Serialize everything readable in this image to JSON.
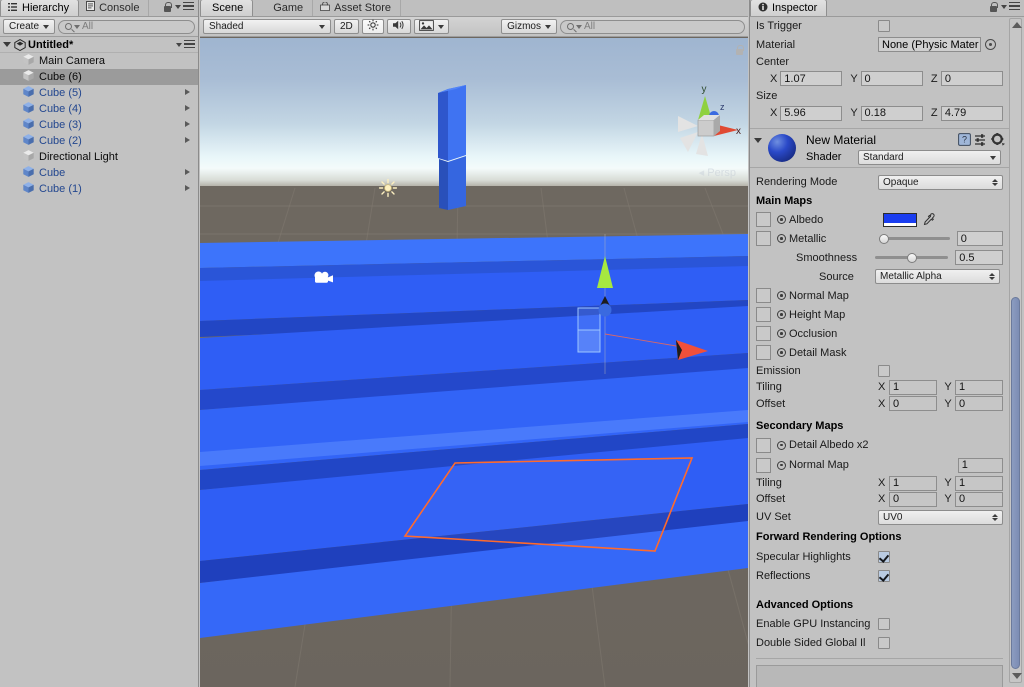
{
  "hierarchy": {
    "tabs": [
      {
        "label": "Hierarchy",
        "icon": "hierarchy-icon",
        "active": true
      },
      {
        "label": "Console",
        "icon": "console-icon",
        "active": false
      }
    ],
    "create_label": "Create",
    "search_placeholder": "All",
    "scene_name": "Untitled*",
    "items": [
      {
        "label": "Main Camera",
        "icon": "gameobject-icon",
        "prefab": false,
        "selected": false,
        "expandable": false
      },
      {
        "label": "Cube (6)",
        "icon": "gameobject-icon",
        "prefab": false,
        "selected": true,
        "expandable": false
      },
      {
        "label": "Cube (5)",
        "icon": "prefab-icon",
        "prefab": true,
        "selected": false,
        "expandable": true
      },
      {
        "label": "Cube (4)",
        "icon": "prefab-icon",
        "prefab": true,
        "selected": false,
        "expandable": true
      },
      {
        "label": "Cube (3)",
        "icon": "prefab-icon",
        "prefab": true,
        "selected": false,
        "expandable": true
      },
      {
        "label": "Cube (2)",
        "icon": "prefab-icon",
        "prefab": true,
        "selected": false,
        "expandable": true
      },
      {
        "label": "Directional Light",
        "icon": "gameobject-icon",
        "prefab": false,
        "selected": false,
        "expandable": false
      },
      {
        "label": "Cube",
        "icon": "prefab-icon",
        "prefab": true,
        "selected": false,
        "expandable": true
      },
      {
        "label": "Cube (1)",
        "icon": "prefab-icon",
        "prefab": true,
        "selected": false,
        "expandable": true
      }
    ]
  },
  "scene": {
    "tabs": [
      {
        "label": "Scene",
        "icon": "scene-icon",
        "active": true
      },
      {
        "label": "Game",
        "icon": "game-icon",
        "active": false
      },
      {
        "label": "Asset Store",
        "icon": "store-icon",
        "active": false
      }
    ],
    "draw_mode": "Shaded",
    "mode_2d": "2D",
    "lighting_icon": "sun-icon",
    "audio_icon": "speaker-icon",
    "effects_icon": "image-icon",
    "gizmos_label": "Gizmos",
    "gizmo_search_placeholder": "All",
    "axis_gizmo": {
      "x": "x",
      "y": "y",
      "z": "z",
      "mode": "Persp"
    },
    "colors": {
      "object_blue": "#2d5cf0",
      "selection_outline": "#ff6a2d",
      "ground": "#6d6760",
      "axis_x": "#f04a33",
      "axis_y": "#9fe03a",
      "axis_z": "#3a6ae0"
    }
  },
  "inspector": {
    "tab_label": "Inspector",
    "collider": {
      "is_trigger_label": "Is Trigger",
      "is_trigger_checked": false,
      "material_label": "Material",
      "material_value": "None (Physic Mater",
      "center_label": "Center",
      "center": {
        "x_label": "X",
        "x": "1.07",
        "y_label": "Y",
        "y": "0",
        "z_label": "Z",
        "z": "0"
      },
      "size_label": "Size",
      "size": {
        "x_label": "X",
        "x": "5.96",
        "y_label": "Y",
        "y": "0.18",
        "z_label": "Z",
        "z": "4.79"
      }
    },
    "material": {
      "name": "New Material",
      "shader_label": "Shader",
      "shader_value": "Standard",
      "rendering_mode_label": "Rendering Mode",
      "rendering_mode_value": "Opaque",
      "main_maps_label": "Main Maps",
      "albedo_label": "Albedo",
      "albedo_color": "#1a3df0",
      "metallic_label": "Metallic",
      "metallic_value": "0",
      "smoothness_label": "Smoothness",
      "smoothness_value": "0.5",
      "source_label": "Source",
      "source_value": "Metallic Alpha",
      "normal_map_label": "Normal Map",
      "height_map_label": "Height Map",
      "occlusion_label": "Occlusion",
      "detail_mask_label": "Detail Mask",
      "emission_label": "Emission",
      "emission_checked": false,
      "tiling_label": "Tiling",
      "tiling": {
        "x_label": "X",
        "x": "1",
        "y_label": "Y",
        "y": "1"
      },
      "offset_label": "Offset",
      "offset": {
        "x_label": "X",
        "x": "0",
        "y_label": "Y",
        "y": "0"
      },
      "secondary_maps_label": "Secondary Maps",
      "detail_albedo_label": "Detail Albedo x2",
      "sec_normal_map_label": "Normal Map",
      "sec_normal_value": "1",
      "sec_tiling_label": "Tiling",
      "sec_tiling": {
        "x_label": "X",
        "x": "1",
        "y_label": "Y",
        "y": "1"
      },
      "sec_offset_label": "Offset",
      "sec_offset": {
        "x_label": "X",
        "x": "0",
        "y_label": "Y",
        "y": "0"
      },
      "uv_set_label": "UV Set",
      "uv_set_value": "UV0",
      "forward_rendering_label": "Forward Rendering Options",
      "specular_highlights_label": "Specular Highlights",
      "specular_highlights_checked": true,
      "reflections_label": "Reflections",
      "reflections_checked": true,
      "advanced_options_label": "Advanced Options",
      "gpu_instancing_label": "Enable GPU Instancing",
      "gpu_instancing_checked": false,
      "double_sided_label": "Double Sided Global Il",
      "double_sided_checked": false
    }
  }
}
